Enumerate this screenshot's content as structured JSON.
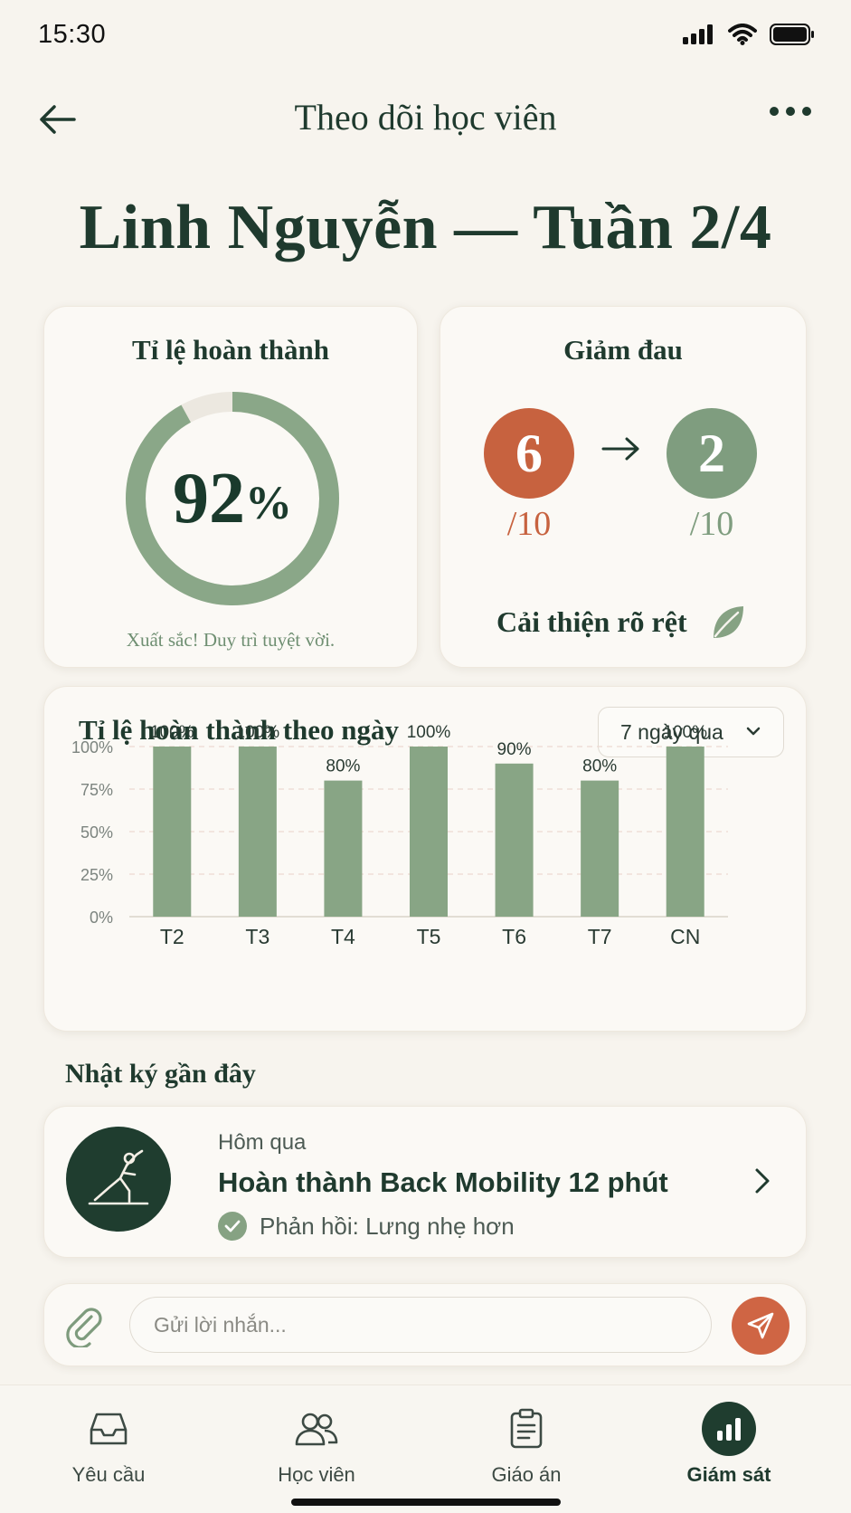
{
  "status_bar": {
    "time": "15:30"
  },
  "header": {
    "title": "Theo dõi học viên"
  },
  "student": {
    "title": "Linh Nguyễn — Tuần 2/4"
  },
  "completion": {
    "heading": "Tỉ lệ hoàn thành",
    "value": "92",
    "unit": "%",
    "fraction": 0.92,
    "caption": "Xuất sắc! Duy trì tuyệt vời.",
    "ring_color": "#8aa788"
  },
  "pain": {
    "heading": "Giảm đau",
    "before": "6",
    "after": "2",
    "before_scale": "/10",
    "after_scale": "/10",
    "note": "Cải thiện rõ rệt",
    "before_color": "#c7623f",
    "after_color": "#7f9d7f"
  },
  "chart_section": {
    "heading": "Tỉ lệ hoàn thành theo ngày",
    "range_selected": "7 ngày qua"
  },
  "chart_data": {
    "type": "bar",
    "categories": [
      "T2",
      "T3",
      "T4",
      "T5",
      "T6",
      "T7",
      "CN"
    ],
    "values": [
      100,
      100,
      80,
      100,
      90,
      80,
      100
    ],
    "value_labels": [
      "100%",
      "100%",
      "80%",
      "100%",
      "90%",
      "80%",
      "100%"
    ],
    "yticks": [
      "0%",
      "25%",
      "50%",
      "75%",
      "100%"
    ],
    "ylim": [
      0,
      100
    ],
    "grid": true,
    "bar_color": "#88a585"
  },
  "recent_log": {
    "section_title": "Nhật ký gần đây",
    "when": "Hôm qua",
    "title": "Hoàn thành Back Mobility 12 phút",
    "feedback": "Phản hồi: Lưng nhẹ hơn"
  },
  "message": {
    "placeholder": "Gửi lời nhắn..."
  },
  "bottom_nav": [
    {
      "label": "Yêu cầu",
      "icon": "inbox-icon",
      "active": false
    },
    {
      "label": "Học viên",
      "icon": "users-icon",
      "active": false
    },
    {
      "label": "Giáo án",
      "icon": "clipboard-icon",
      "active": false
    },
    {
      "label": "Giám sát",
      "icon": "bar-chart-icon",
      "active": true
    }
  ],
  "colors": {
    "background": "#f7f4ee",
    "primary_dark": "#1f3d2f",
    "accent_orange": "#cf6544",
    "accent_green": "#88a585"
  }
}
